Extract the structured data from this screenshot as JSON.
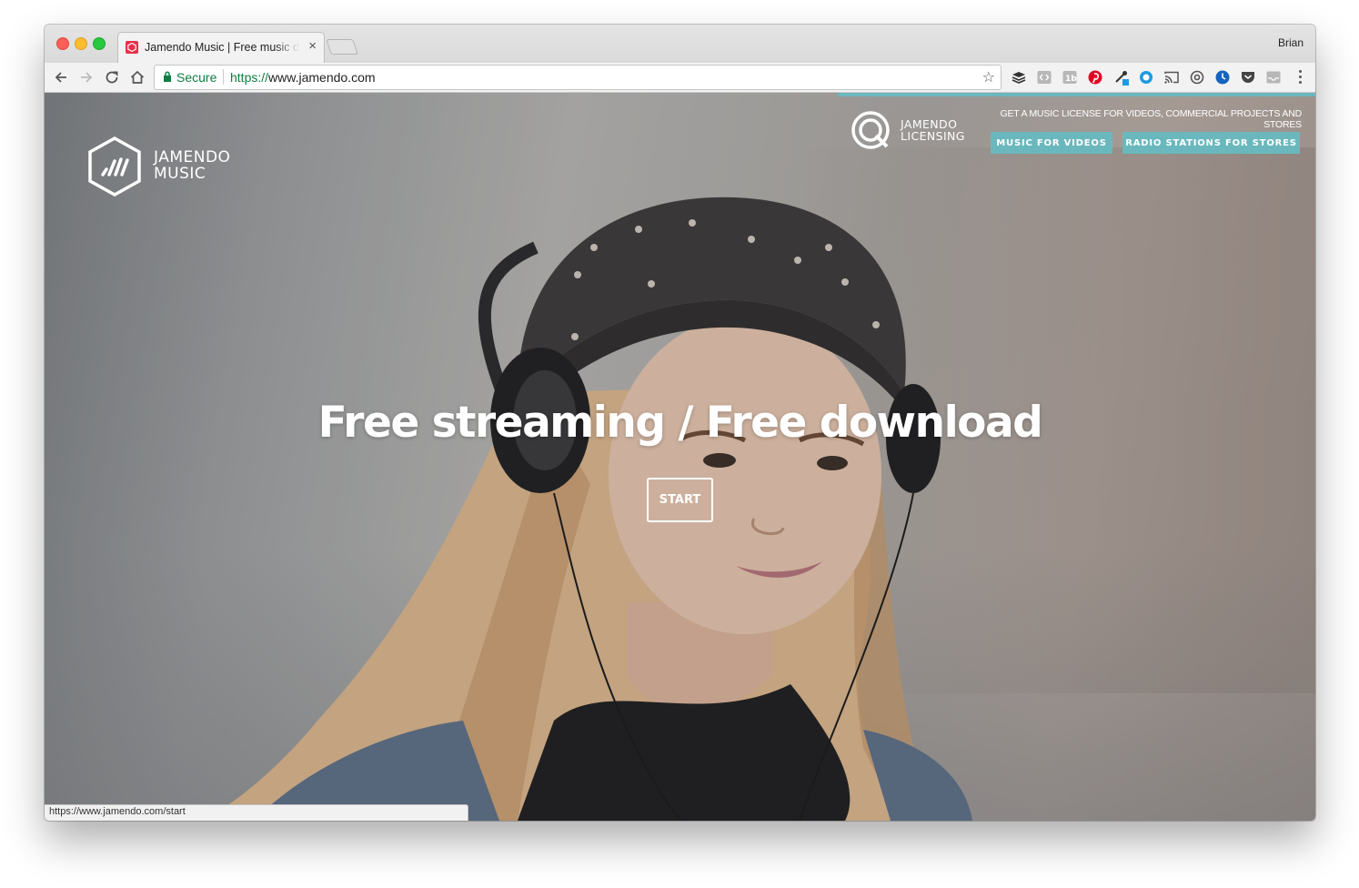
{
  "browser": {
    "tab_title": "Jamendo Music | Free music d",
    "tab_close": "×",
    "profile_name": "Brian",
    "security_label": "Secure",
    "url_scheme": "https://",
    "url_host": "www.jamendo.com",
    "bookmark_star": "☆",
    "status_url": "https://www.jamendo.com/start",
    "icons": [
      "back-icon",
      "forward-icon",
      "reload-icon",
      "home-icon",
      "lock-icon",
      "star-icon",
      "buffer-icon",
      "code-icon",
      "onetab-icon",
      "pinterest-icon",
      "eyedropper-icon",
      "circle-icon",
      "cast-icon",
      "settings-icon",
      "clock-icon",
      "pocket-icon",
      "inbox-icon",
      "menu-icon"
    ]
  },
  "page": {
    "brand_line1": "JAMENDO",
    "brand_line2": "MUSIC",
    "licensing_line1": "JAMENDO",
    "licensing_line2": "LICENSING",
    "licensing_tagline": "GET A MUSIC LICENSE FOR VIDEOS, COMMERCIAL PROJECTS AND STORES",
    "btn_videos": "MUSIC FOR VIDEOS",
    "btn_stores": "RADIO STATIONS FOR STORES",
    "headline": "Free streaming / Free download",
    "start_label": "START"
  },
  "colors": {
    "accent": "#6ab8bd",
    "secure_green": "#0b8043",
    "favicon": "#e8304a"
  }
}
